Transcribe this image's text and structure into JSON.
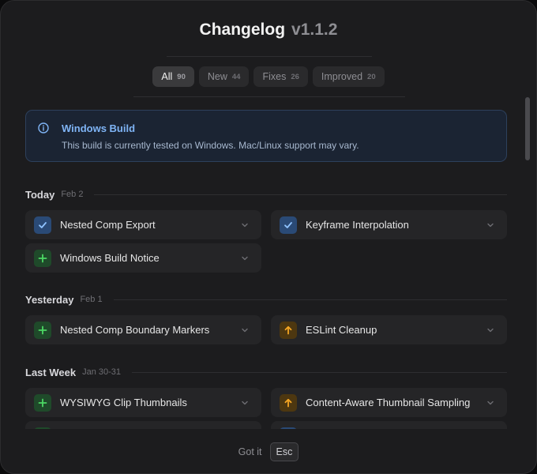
{
  "header": {
    "title": "Changelog",
    "version": "v1.1.2"
  },
  "tabs": [
    {
      "label": "All",
      "count": "90",
      "active": true
    },
    {
      "label": "New",
      "count": "44"
    },
    {
      "label": "Fixes",
      "count": "26"
    },
    {
      "label": "Improved",
      "count": "20"
    }
  ],
  "notice": {
    "icon": "info-icon",
    "title": "Windows Build",
    "text": "This build is currently tested on Windows. Mac/Linux support may vary."
  },
  "sections": [
    {
      "name": "Today",
      "date": "Feb 2",
      "items": [
        {
          "label": "Nested Comp Export",
          "icon": "check-icon",
          "kind": "improved"
        },
        {
          "label": "Keyframe Interpolation",
          "icon": "check-icon",
          "kind": "improved"
        },
        {
          "label": "Windows Build Notice",
          "icon": "plus-icon",
          "kind": "new"
        }
      ]
    },
    {
      "name": "Yesterday",
      "date": "Feb 1",
      "items": [
        {
          "label": "Nested Comp Boundary Markers",
          "icon": "plus-icon",
          "kind": "new"
        },
        {
          "label": "ESLint Cleanup",
          "icon": "arrow-up-icon",
          "kind": "fix"
        }
      ]
    },
    {
      "name": "Last Week",
      "date": "Jan 30-31",
      "items": [
        {
          "label": "WYSIWYG Clip Thumbnails",
          "icon": "plus-icon",
          "kind": "new"
        },
        {
          "label": "Content-Aware Thumbnail Sampling",
          "icon": "arrow-up-icon",
          "kind": "fix"
        }
      ]
    }
  ],
  "footer": {
    "dismiss_label": "Got it",
    "key_label": "Esc"
  },
  "colors": {
    "accent_blue": "#7fb4f5",
    "new_green": "#4cd964",
    "fix_orange": "#f5a623"
  }
}
